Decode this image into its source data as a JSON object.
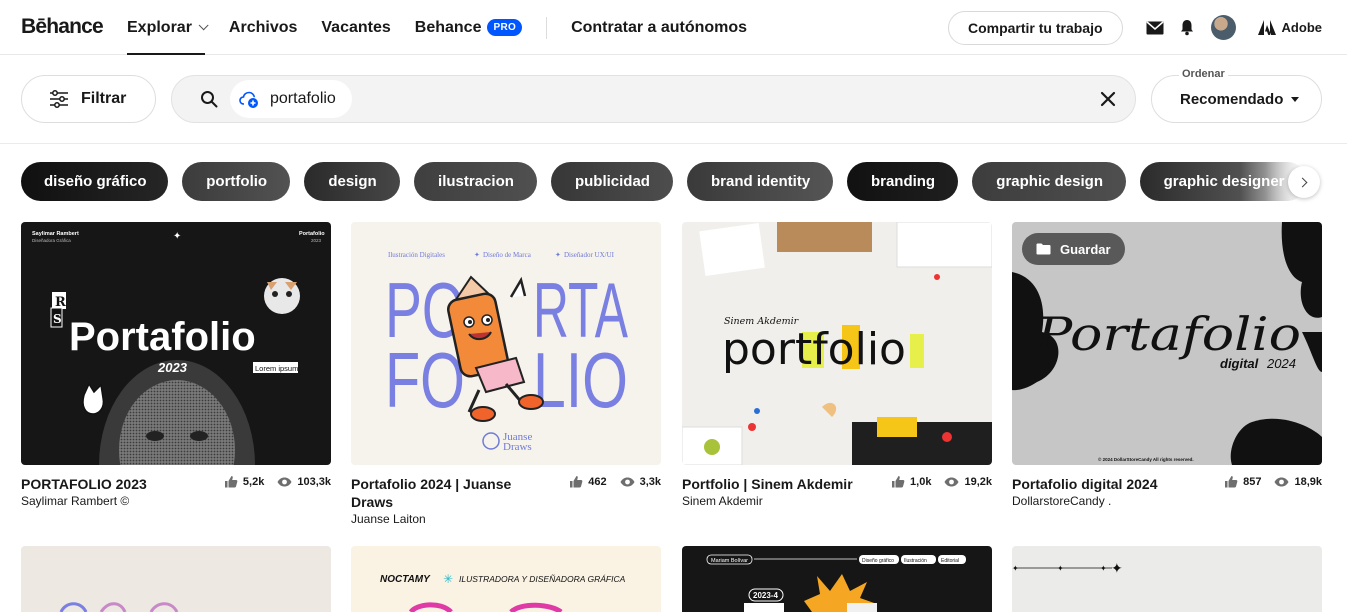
{
  "header": {
    "logo": "Bēhance",
    "nav": {
      "explore": "Explorar",
      "assets": "Archivos",
      "jobs": "Vacantes",
      "behance": "Behance",
      "pro_badge": "PRO",
      "hire": "Contratar a autónomos"
    },
    "share_button": "Compartir tu trabajo",
    "adobe": "Adobe"
  },
  "search": {
    "filter_label": "Filtrar",
    "query": "portafolio",
    "sort_label": "Ordenar",
    "sort_value": "Recomendado"
  },
  "tags": [
    "diseño gráfico",
    "portfolio",
    "design",
    "ilustracion",
    "publicidad",
    "brand identity",
    "branding",
    "graphic design",
    "graphic designer"
  ],
  "cards": [
    {
      "title": "PORTAFOLIO 2023",
      "author": "Saylimar Rambert ©",
      "likes": "5,2k",
      "views": "103,3k",
      "thumb": {
        "top_left_name": "Saylimar Rambert",
        "top_left_sub": "Diseñadora Gráfica",
        "top_right": "Portafolio",
        "top_right_year": "2023",
        "big_text": "Portafolio",
        "year": "2023",
        "tag": "Lorem ipsum"
      }
    },
    {
      "title": "Portafolio 2024 | Juanse Draws",
      "author": "Juanse Laiton",
      "likes": "462",
      "views": "3,3k",
      "thumb": {
        "line": [
          "Ilustración Digitales",
          "Diseño de Marca",
          "Diseñador UX/UI"
        ],
        "big_left_top": "PO",
        "big_right_top": "RTA",
        "big_left_bottom": "FO",
        "big_right_bottom": "LIO",
        "brand_1": "Juanse",
        "brand_2": "Draws"
      }
    },
    {
      "title": "Portfolio | Sinem Akdemir",
      "author": "Sinem Akdemir",
      "likes": "1,0k",
      "views": "19,2k",
      "thumb": {
        "script": "Sinem Akdemir",
        "big_text": "portfolio"
      }
    },
    {
      "title": "Portafolio digital 2024",
      "author": "DollarstoreCandy .",
      "likes": "857",
      "views": "18,9k",
      "save_label": "Guardar",
      "thumb": {
        "big_text": "Portafolio",
        "sub_text_a": "digital",
        "sub_text_b": "2024",
        "fine_print": "© 2024 DollarStoreCandy All rights reserved."
      }
    }
  ],
  "row2": {
    "card2_text_a": "NOCTAMY",
    "card2_text_b": "ILUSTRADORA Y DISEÑADORA GRÁFICA",
    "card3_name": "Mariam Bolívar",
    "card3_tags": [
      "Diseño gráfico",
      "Ilustración",
      "Editorial"
    ],
    "card3_year": "2023-4"
  },
  "colors": {
    "accent": "#0057ff",
    "text": "#191919"
  }
}
